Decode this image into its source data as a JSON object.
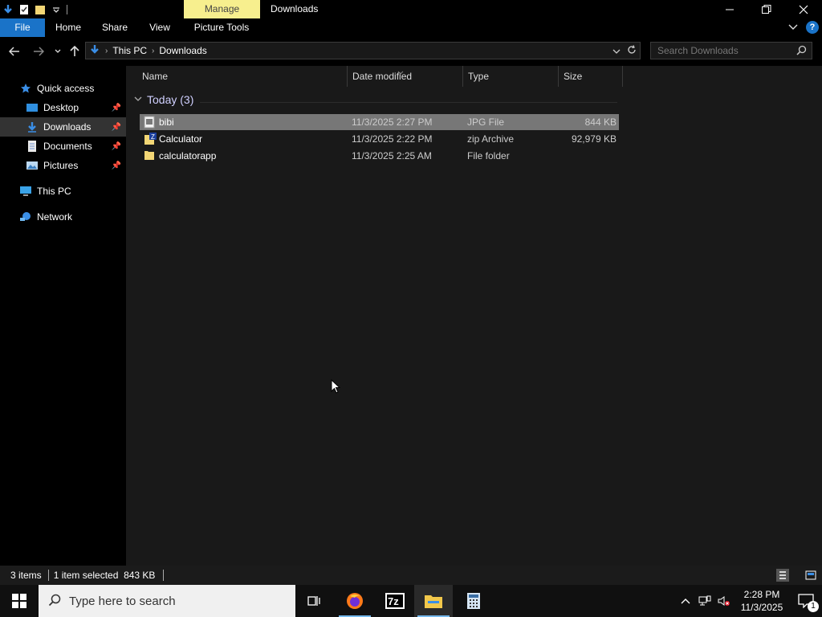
{
  "window": {
    "title": "Downloads",
    "context_tab": "Manage"
  },
  "ribbon": {
    "tabs": [
      "File",
      "Home",
      "Share",
      "View",
      "Picture Tools"
    ]
  },
  "address": {
    "segments": [
      "This PC",
      "Downloads"
    ],
    "search_placeholder": "Search Downloads"
  },
  "nav": {
    "items": [
      {
        "label": "Quick access",
        "icon": "star-icon"
      },
      {
        "label": "Desktop",
        "icon": "desktop-icon"
      },
      {
        "label": "Downloads",
        "icon": "download-icon"
      },
      {
        "label": "Documents",
        "icon": "documents-icon"
      },
      {
        "label": "Pictures",
        "icon": "pictures-icon"
      },
      {
        "label": "This PC",
        "icon": "computer-icon"
      },
      {
        "label": "Network",
        "icon": "network-icon"
      }
    ]
  },
  "columns": [
    "Name",
    "Date modified",
    "Type",
    "Size"
  ],
  "group": {
    "label": "Today (3)"
  },
  "files": [
    {
      "name": "bibi",
      "date": "11/3/2025 2:27 PM",
      "type": "JPG File",
      "size": "844 KB",
      "selected": true
    },
    {
      "name": "Calculator",
      "date": "11/3/2025 2:22 PM",
      "type": "zip Archive",
      "size": "92,979 KB",
      "selected": false
    },
    {
      "name": "calculatorapp",
      "date": "11/3/2025 2:25 AM",
      "type": "File folder",
      "size": "",
      "selected": false
    }
  ],
  "status": {
    "count": "3 items",
    "selection": "1 item selected  843 KB"
  },
  "taskbar": {
    "search_text": "Type here to search",
    "time": "2:28 PM",
    "date": "11/3/2025",
    "notification_count": "1"
  },
  "colors": {
    "accent": "#1a73c8",
    "context_tab": "#f7ef8e",
    "selected_row": "#777777"
  }
}
